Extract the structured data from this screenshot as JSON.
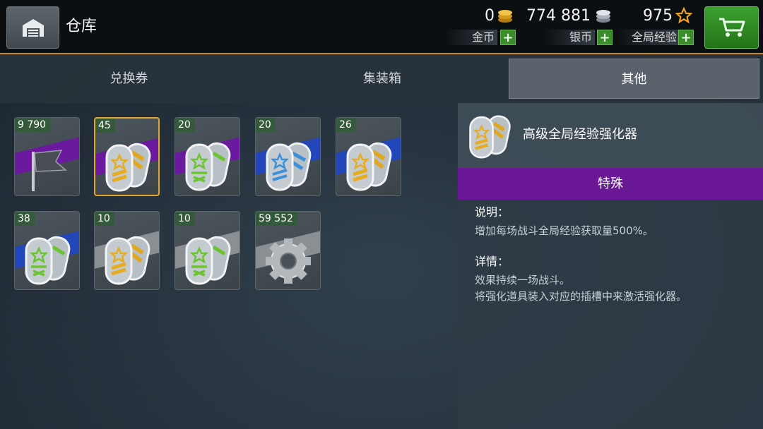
{
  "header": {
    "title": "仓库",
    "currencies": [
      {
        "value": "0",
        "label": "金币",
        "icon": "gold-coins-icon"
      },
      {
        "value": "774 881",
        "label": "银币",
        "icon": "silver-coins-icon"
      },
      {
        "value": "975",
        "label": "全局经验",
        "icon": "star-icon"
      }
    ],
    "add_symbol": "+"
  },
  "tabs": [
    {
      "label": "兑换券",
      "active": false
    },
    {
      "label": "集装箱",
      "active": false
    },
    {
      "label": "其他",
      "active": true
    }
  ],
  "items": [
    {
      "count": "9 790",
      "icon": "flag-icon",
      "stripe": "#6b1aa0"
    },
    {
      "count": "45",
      "icon": "gold-xp-booster-icon",
      "stripe": "#6b1aa0",
      "selected": true
    },
    {
      "count": "20",
      "icon": "green-crew-booster-icon",
      "stripe": "#6b1aa0"
    },
    {
      "count": "20",
      "icon": "blue-booster-icon",
      "stripe": "#2246b8"
    },
    {
      "count": "26",
      "icon": "gold-xp-booster-icon",
      "stripe": "#2246b8"
    },
    {
      "count": "38",
      "icon": "green-crew-booster-icon",
      "stripe": "#2246b8"
    },
    {
      "count": "10",
      "icon": "gold-xp-booster-icon",
      "stripe": "#8a8f93"
    },
    {
      "count": "10",
      "icon": "green-crew-booster-icon",
      "stripe": "#8a8f93"
    },
    {
      "count": "59 552",
      "icon": "gear-icon",
      "stripe": "#8a8f93"
    }
  ],
  "detail": {
    "name": "高级全局经验强化器",
    "rarity": "特殊",
    "rarity_color": "#6b1896",
    "description_title": "说明：",
    "description": "增加每场战斗全局经验获取量500%。",
    "details_title": "详情：",
    "details_lines": [
      "效果持续一场战斗。",
      "将强化道具装入对应的插槽中来激活强化器。"
    ]
  }
}
